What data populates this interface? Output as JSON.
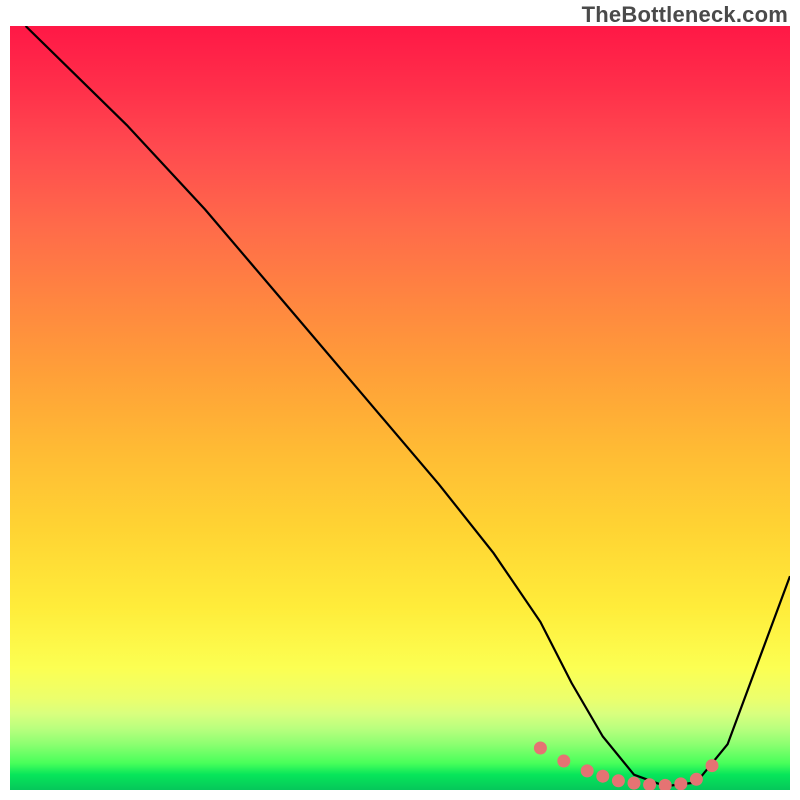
{
  "watermark": "TheBottleneck.com",
  "chart_data": {
    "type": "line",
    "title": "",
    "xlabel": "",
    "ylabel": "",
    "xlim": [
      0,
      100
    ],
    "ylim": [
      0,
      100
    ],
    "grid": false,
    "legend": false,
    "series": [
      {
        "name": "curve",
        "color": "#000000",
        "x": [
          2,
          8,
          15,
          25,
          35,
          45,
          55,
          62,
          68,
          72,
          76,
          80,
          84,
          88,
          92,
          100
        ],
        "y": [
          100,
          94,
          87,
          76,
          64,
          52,
          40,
          31,
          22,
          14,
          7,
          2,
          0.5,
          1,
          6,
          28
        ]
      }
    ],
    "highlight_segment": {
      "name": "salmon-dots",
      "color": "#e57373",
      "x": [
        68,
        71,
        74,
        76,
        78,
        80,
        82,
        84,
        86,
        88,
        90
      ],
      "y": [
        5.5,
        3.8,
        2.5,
        1.8,
        1.2,
        0.9,
        0.7,
        0.6,
        0.8,
        1.4,
        3.2
      ]
    },
    "background_gradient": {
      "top": "#ff1846",
      "mid": "#ffec3a",
      "bottom": "#05c75a"
    }
  }
}
